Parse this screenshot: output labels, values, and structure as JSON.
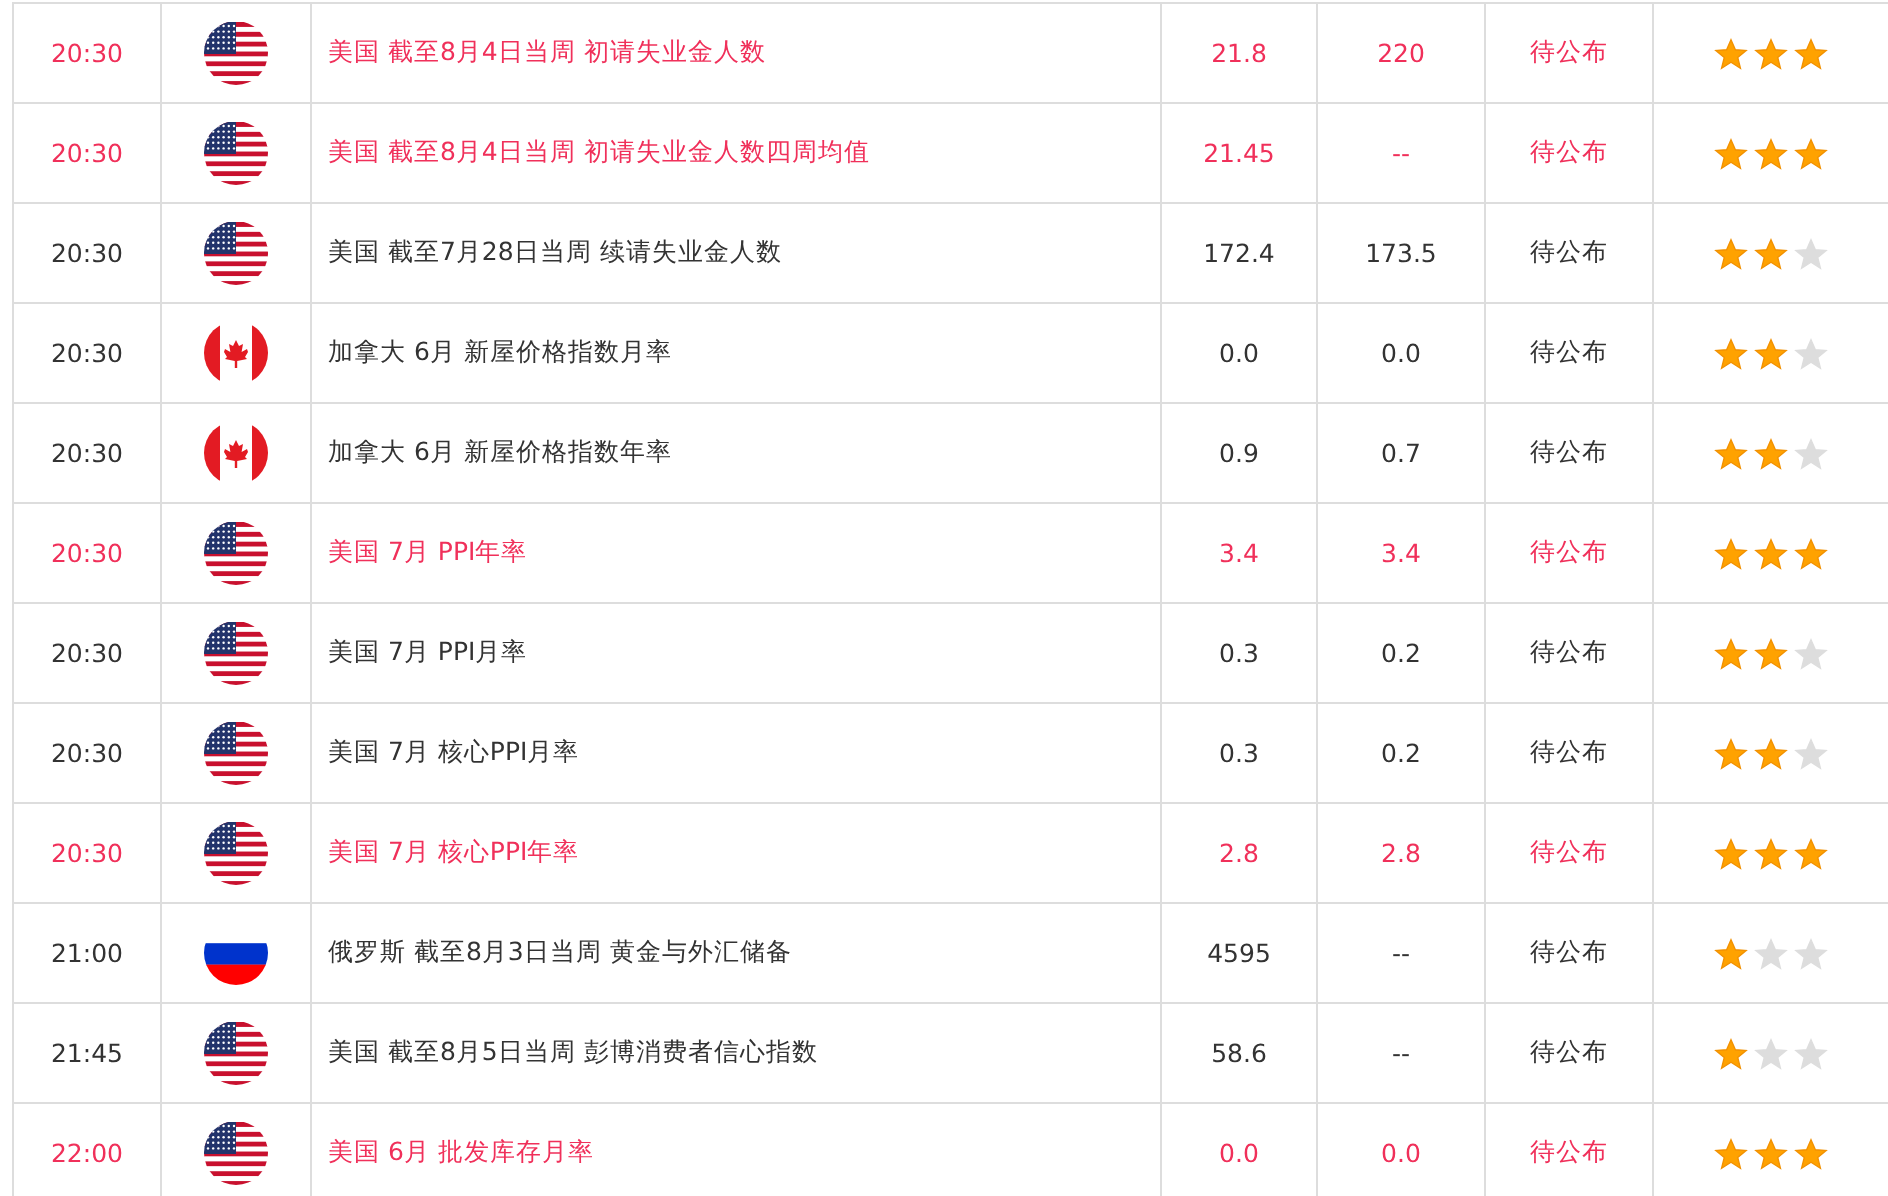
{
  "rows": [
    {
      "time": "20:30",
      "kind": "us",
      "event": "美国 截至8月4日当周 初请失业金人数",
      "column_4": "21.8",
      "column_5": "220",
      "column_6": "待公布",
      "stars": 3
    },
    {
      "time": "20:30",
      "kind": "us",
      "event": "美国 截至8月4日当周 初请失业金人数四周均值",
      "column_4": "21.45",
      "column_5": "--",
      "column_6": "待公布",
      "stars": 3
    },
    {
      "time": "20:30",
      "kind": "us",
      "event": "美国 截至7月28日当周 续请失业金人数",
      "column_4": "172.4",
      "column_5": "173.5",
      "column_6": "待公布",
      "stars": 2
    },
    {
      "time": "20:30",
      "kind": "ca",
      "event": "加拿大 6月 新屋价格指数月率",
      "column_4": "0.0",
      "column_5": "0.0",
      "column_6": "待公布",
      "stars": 2
    },
    {
      "time": "20:30",
      "kind": "ca",
      "event": "加拿大 6月 新屋价格指数年率",
      "column_4": "0.9",
      "column_5": "0.7",
      "column_6": "待公布",
      "stars": 2
    },
    {
      "time": "20:30",
      "kind": "us",
      "event": "美国 7月 PPI年率",
      "column_4": "3.4",
      "column_5": "3.4",
      "column_6": "待公布",
      "stars": 3
    },
    {
      "time": "20:30",
      "kind": "us",
      "event": "美国 7月 PPI月率",
      "column_4": "0.3",
      "column_5": "0.2",
      "column_6": "待公布",
      "stars": 2
    },
    {
      "time": "20:30",
      "kind": "us",
      "event": "美国 7月 核心PPI月率",
      "column_4": "0.3",
      "column_5": "0.2",
      "column_6": "待公布",
      "stars": 2
    },
    {
      "time": "20:30",
      "kind": "us",
      "event": "美国 7月 核心PPI年率",
      "column_4": "2.8",
      "column_5": "2.8",
      "column_6": "待公布",
      "stars": 3
    },
    {
      "time": "21:00",
      "kind": "ru",
      "event": "俄罗斯 截至8月3日当周 黄金与外汇储备",
      "column_4": "4595",
      "column_5": "--",
      "column_6": "待公布",
      "stars": 1
    },
    {
      "time": "21:45",
      "kind": "us",
      "event": "美国 截至8月5日当周 彭博消费者信心指数",
      "column_4": "58.6",
      "column_5": "--",
      "column_6": "待公布",
      "stars": 1
    },
    {
      "time": "22:00",
      "kind": "us",
      "event": "美国 6月 批发库存月率",
      "column_4": "0.0",
      "column_5": "0.0",
      "column_6": "待公布",
      "stars": 3
    }
  ]
}
